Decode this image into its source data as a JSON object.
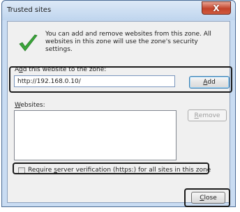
{
  "window": {
    "title": "Trusted sites",
    "close_glyph": "X"
  },
  "intro": {
    "icon": "green-checkmark-icon",
    "text": "You can add and remove websites from this zone. All websites in this zone will use the zone's security settings."
  },
  "add_site": {
    "label_prefix": "A",
    "label_mnemonic": "d",
    "label_rest": "d this website to the zone:",
    "value": "http://192.168.0.10/",
    "button_mnemonic": "A",
    "button_rest": "dd"
  },
  "websites": {
    "label_mnemonic": "W",
    "label_rest": "ebsites:",
    "items": [],
    "remove_mnemonic": "R",
    "remove_rest": "emove"
  },
  "require_verification": {
    "checked": false,
    "label_prefix": "Require ",
    "label_mnemonic": "s",
    "label_rest": "erver verification (https:) for all sites in this zone"
  },
  "footer": {
    "close_mnemonic": "C",
    "close_rest": "lose"
  },
  "colors": {
    "frame": "#c9dcf2",
    "close_button": "#c3432b",
    "check_green": "#3aa63a",
    "highlight_box": "#1b1b1b"
  }
}
